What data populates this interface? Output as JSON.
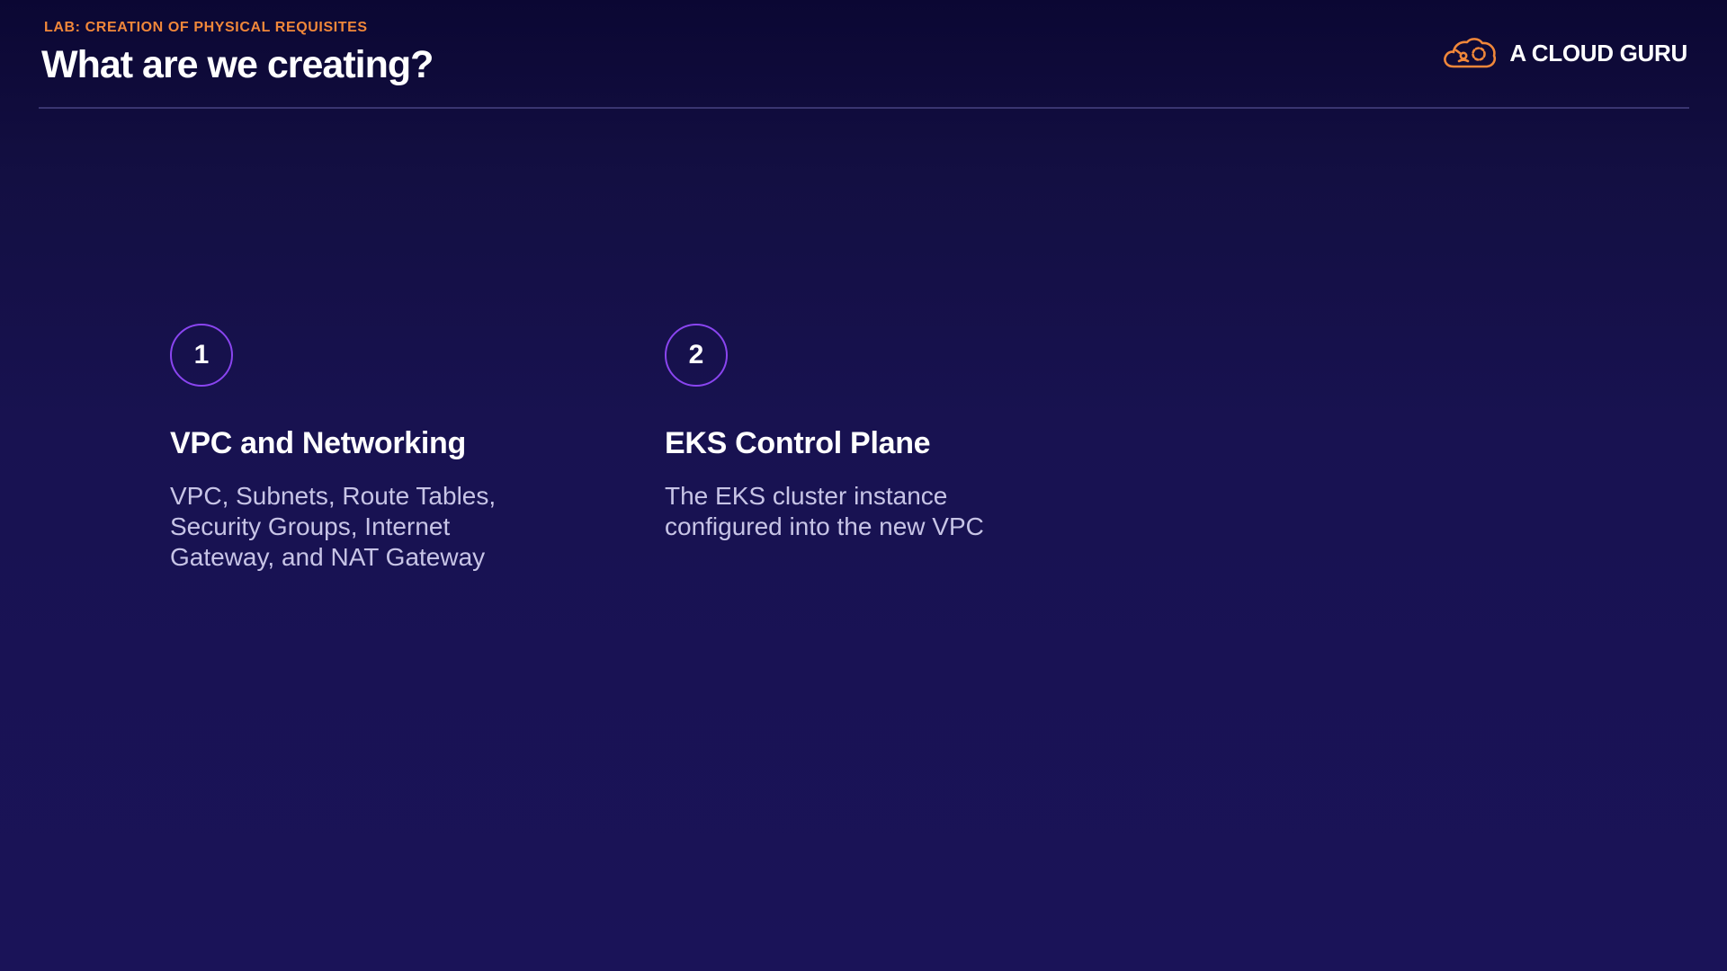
{
  "header": {
    "kicker": "LAB: CREATION OF PHYSICAL REQUISITES",
    "title": "What are we creating?",
    "brand_name": "A CLOUD GURU",
    "brand_icon": "cloud-logo-icon"
  },
  "colors": {
    "accent_orange": "#f0873a",
    "circle_purple": "#8a45f0",
    "background_dark": "#0b0733",
    "background": "#1a1358"
  },
  "steps": [
    {
      "number": "1",
      "title": "VPC and Networking",
      "description": "VPC, Subnets, Route Tables,\nSecurity Groups, Internet\nGateway, and NAT Gateway"
    },
    {
      "number": "2",
      "title": "EKS Control Plane",
      "description": "The EKS cluster instance\nconfigured into the new VPC"
    }
  ]
}
